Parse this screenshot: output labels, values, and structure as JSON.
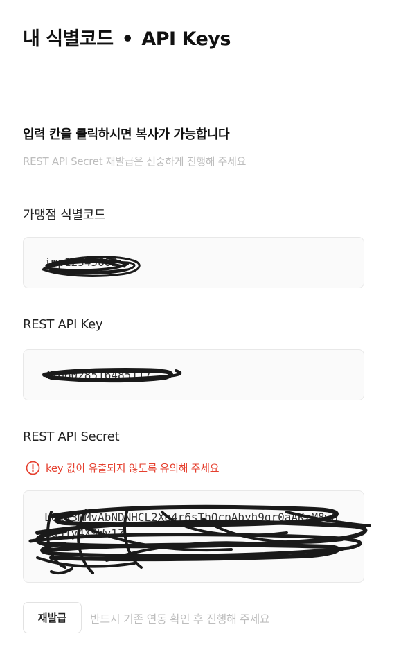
{
  "header": {
    "title_part1": "내 식별코드",
    "separator": "•",
    "title_part2": "API Keys"
  },
  "intro": {
    "heading": "입력 칸을 클릭하시면 복사가 가능합니다",
    "subtext": "REST API Secret 재발급은 신중하게 진행해 주세요"
  },
  "fields": {
    "merchant_code": {
      "label": "가맹점 식별코드",
      "value": "imp12345662"
    },
    "rest_api_key": {
      "label": "REST API Key",
      "value": "4166028516485117"
    },
    "rest_api_secret": {
      "label": "REST API Secret",
      "warning_text": "key 값이 유출되지 않도록 유의해 주세요",
      "warning_icon": "exclamation-circle-icon",
      "value": "L0xk3MMvAbNDNHCL2Xe4r6sThQcpAbyh9gr0aAKzM8w8xa3jy4X9Wv1Z"
    }
  },
  "actions": {
    "reissue_label": "재발급",
    "reissue_hint": "반드시 기존 연동 확인 후 진행해 주세요"
  },
  "colors": {
    "warning": "#e5402f",
    "muted_text": "#bdbdbd",
    "field_background": "#fafafa",
    "field_border": "#e8e8e8",
    "redaction": "#1a1a1a"
  }
}
